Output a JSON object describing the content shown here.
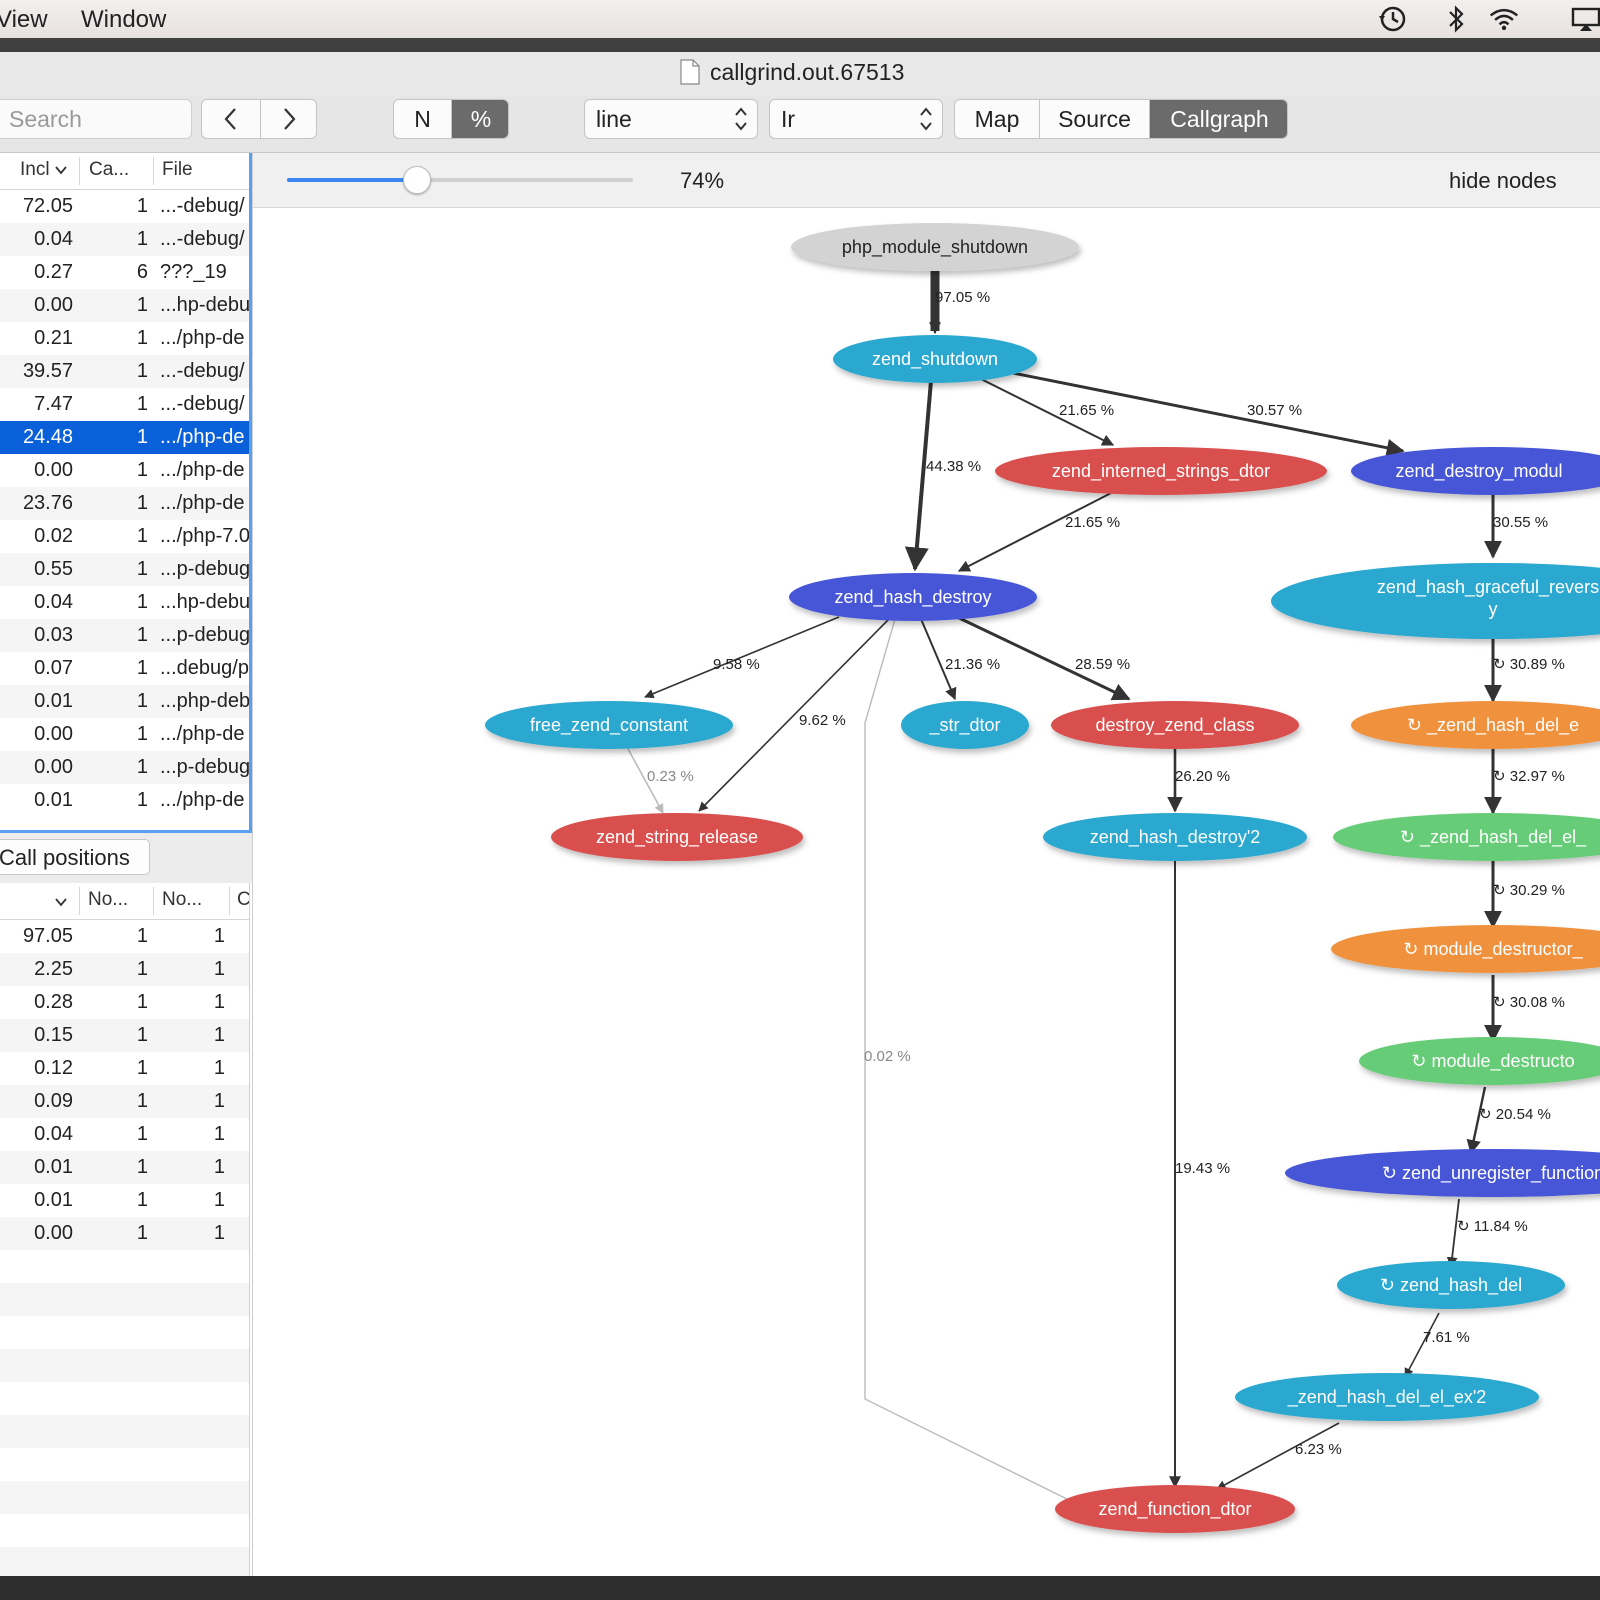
{
  "menubar": {
    "items": [
      "View",
      "Window"
    ]
  },
  "window": {
    "title": "callgrind.out.67513"
  },
  "toolbar": {
    "search_placeholder": "Search",
    "nav_back": "<",
    "nav_forward": ">",
    "mode_n": "N",
    "mode_pct": "%",
    "grouping_select": "line",
    "event_select": "Ir",
    "view_map": "Map",
    "view_source": "Source",
    "view_callgraph": "Callgraph"
  },
  "top_table": {
    "headers": [
      "Incl",
      "Ca...",
      "File"
    ],
    "rows": [
      [
        "72.05",
        "1",
        "...-debug/"
      ],
      [
        "0.04",
        "1",
        "...-debug/"
      ],
      [
        "0.27",
        "6",
        "???_19"
      ],
      [
        "0.00",
        "1",
        "...hp-debu"
      ],
      [
        "0.21",
        "1",
        ".../php-de"
      ],
      [
        "39.57",
        "1",
        "...-debug/"
      ],
      [
        "7.47",
        "1",
        "...-debug/"
      ],
      [
        "24.48",
        "1",
        ".../php-de"
      ],
      [
        "0.00",
        "1",
        ".../php-de"
      ],
      [
        "23.76",
        "1",
        ".../php-de"
      ],
      [
        "0.02",
        "1",
        ".../php-7.0"
      ],
      [
        "0.55",
        "1",
        "...p-debug"
      ],
      [
        "0.04",
        "1",
        "...hp-debu"
      ],
      [
        "0.03",
        "1",
        "...p-debug"
      ],
      [
        "0.07",
        "1",
        "...debug/p"
      ],
      [
        "0.01",
        "1",
        "...php-deb"
      ],
      [
        "0.00",
        "1",
        ".../php-de"
      ],
      [
        "0.00",
        "1",
        "...p-debug"
      ],
      [
        "0.01",
        "1",
        ".../php-de"
      ]
    ]
  },
  "bottom_tab": "Call positions",
  "bottom_table": {
    "headers": [
      "No...",
      "No...",
      "C"
    ],
    "rows": [
      [
        "97.05",
        "1",
        "1"
      ],
      [
        "2.25",
        "1",
        "1"
      ],
      [
        "0.28",
        "1",
        "1"
      ],
      [
        "0.15",
        "1",
        "1"
      ],
      [
        "0.12",
        "1",
        "1"
      ],
      [
        "0.09",
        "1",
        "1"
      ],
      [
        "0.04",
        "1",
        "1"
      ],
      [
        "0.01",
        "1",
        "1"
      ],
      [
        "0.01",
        "1",
        "1"
      ],
      [
        "0.00",
        "1",
        "1"
      ]
    ]
  },
  "graph_toolbar": {
    "zoom": "74%",
    "zoom_fraction": 0.375,
    "hide_nodes": "hide nodes"
  },
  "graph": {
    "nodes": {
      "php_module_shutdown": "php_module_shutdown",
      "zend_shutdown": "zend_shutdown",
      "zend_interned_strings_dtor": "zend_interned_strings_dtor",
      "zend_destroy_modul": "zend_destroy_modul",
      "zend_hash_destroy": "zend_hash_destroy",
      "zend_hash_graceful_revers_1": "zend_hash_graceful_reverse",
      "zend_hash_graceful_revers_2": "y",
      "free_zend_constant": "free_zend_constant",
      "str_dtor": "_str_dtor",
      "destroy_zend_class": "destroy_zend_class",
      "zend_hash_del_e1": "_zend_hash_del_e",
      "zend_string_release": "zend_string_release",
      "zend_hash_destroy2": "zend_hash_destroy'2",
      "zend_hash_del_el": "_zend_hash_del_el_",
      "module_destructor_1": "module_destructor_",
      "module_destruct": "module_destructo",
      "zend_unregister_function": "zend_unregister_function",
      "zend_hash_del": "zend_hash_del",
      "zend_hash_del_el_ex2": "_zend_hash_del_el_ex'2",
      "zend_function_dtor": "zend_function_dtor"
    },
    "edges": {
      "e1": "97.05 %",
      "e2": "21.65 %",
      "e3": "30.57 %",
      "e4": "44.38 %",
      "e5": "21.65 %",
      "e6": "30.55 %",
      "e7": "9.58 %",
      "e8": "9.62 %",
      "e9": "21.36 %",
      "e10": "28.59 %",
      "e11": "30.89 %",
      "e12": "0.23 %",
      "e13": "26.20 %",
      "e14": "32.97 %",
      "e15": "30.29 %",
      "e16": "0.02 %",
      "e17": "30.08 %",
      "e18": "20.54 %",
      "e19": "19.43 %",
      "e20": "11.84 %",
      "e21": "7.61 %",
      "e22": "6.23 %"
    },
    "colors": {
      "cyan": "#2aa8cf",
      "red": "#d9504e",
      "blue": "#4756d6",
      "orange": "#f0923e",
      "green": "#66cc77",
      "gray": "#d3d3d3"
    }
  }
}
